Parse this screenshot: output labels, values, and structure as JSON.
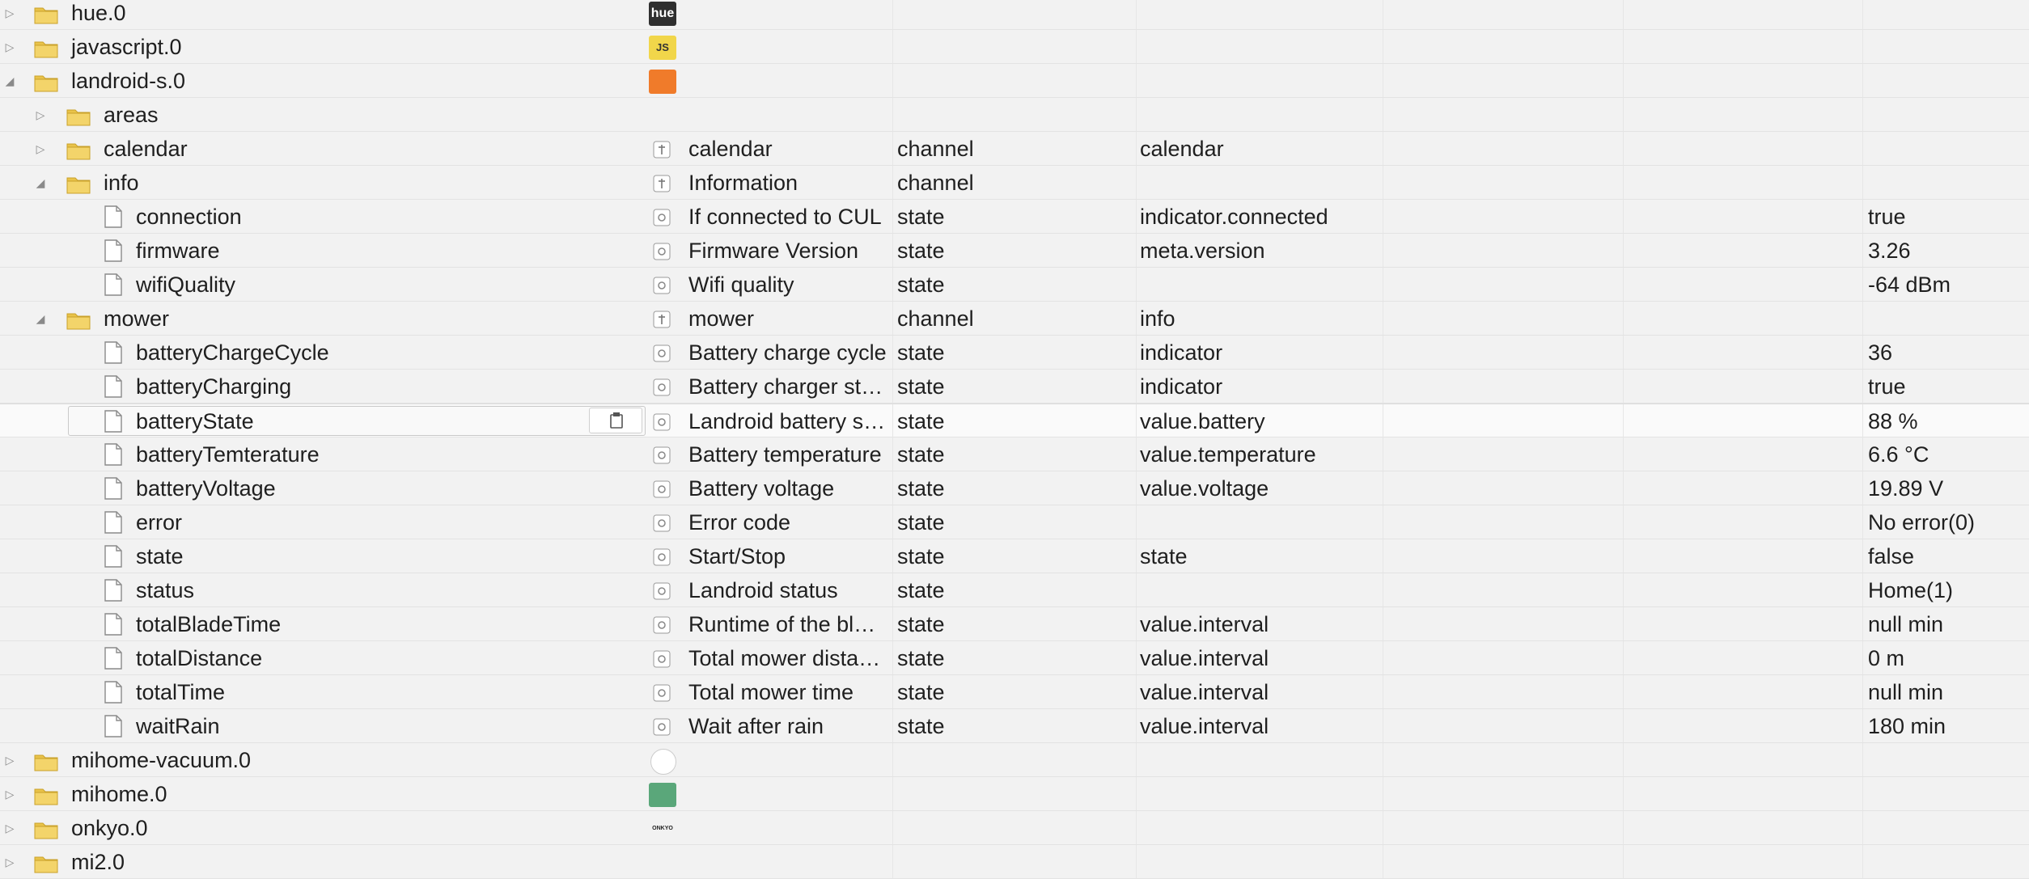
{
  "rows": [
    {
      "kind": "adapter",
      "name": "hue.0",
      "expanded": false,
      "icon": "hue-adapter-icon",
      "icon_text": "hue"
    },
    {
      "kind": "adapter",
      "name": "javascript.0",
      "expanded": false,
      "icon": "javascript-adapter-icon",
      "icon_text": "JS"
    },
    {
      "kind": "adapter",
      "name": "landroid-s.0",
      "expanded": true,
      "icon": "landroid-adapter-icon",
      "icon_text": ""
    },
    {
      "kind": "folder",
      "level": 1,
      "name": "areas",
      "expanded": false
    },
    {
      "kind": "channel",
      "level": 1,
      "name": "calendar",
      "expanded": false,
      "col_name": "calendar",
      "type": "channel",
      "role": "calendar",
      "value": ""
    },
    {
      "kind": "channel",
      "level": 1,
      "name": "info",
      "expanded": true,
      "col_name": "Information",
      "type": "channel",
      "role": "",
      "value": ""
    },
    {
      "kind": "state",
      "level": 2,
      "name": "connection",
      "col_name": "If connected to CUL",
      "type": "state",
      "role": "indicator.connected",
      "value": "true"
    },
    {
      "kind": "state",
      "level": 2,
      "name": "firmware",
      "col_name": "Firmware Version",
      "type": "state",
      "role": "meta.version",
      "value": "3.26"
    },
    {
      "kind": "state",
      "level": 2,
      "name": "wifiQuality",
      "col_name": "Wifi quality",
      "type": "state",
      "role": "",
      "value": "-64 dBm"
    },
    {
      "kind": "channel",
      "level": 1,
      "name": "mower",
      "expanded": true,
      "col_name": "mower",
      "type": "channel",
      "role": "info",
      "value": ""
    },
    {
      "kind": "state",
      "level": 2,
      "name": "batteryChargeCycle",
      "col_name": "Battery charge cycle",
      "type": "state",
      "role": "indicator",
      "value": "36"
    },
    {
      "kind": "state",
      "level": 2,
      "name": "batteryCharging",
      "col_name": "Battery charger st…",
      "type": "state",
      "role": "indicator",
      "value": "true"
    },
    {
      "kind": "state",
      "level": 2,
      "name": "batteryState",
      "col_name": "Landroid battery s…",
      "type": "state",
      "role": "value.battery",
      "value": "88 %",
      "selected": true
    },
    {
      "kind": "state",
      "level": 2,
      "name": "batteryTemterature",
      "col_name": "Battery temperature",
      "type": "state",
      "role": "value.temperature",
      "value": "6.6 °C"
    },
    {
      "kind": "state",
      "level": 2,
      "name": "batteryVoltage",
      "col_name": "Battery voltage",
      "type": "state",
      "role": "value.voltage",
      "value": "19.89 V"
    },
    {
      "kind": "state",
      "level": 2,
      "name": "error",
      "col_name": "Error code",
      "type": "state",
      "role": "",
      "value": "No error(0)"
    },
    {
      "kind": "state",
      "level": 2,
      "name": "state",
      "col_name": "Start/Stop",
      "type": "state",
      "role": "state",
      "value": "false"
    },
    {
      "kind": "state",
      "level": 2,
      "name": "status",
      "col_name": "Landroid status",
      "type": "state",
      "role": "",
      "value": "Home(1)"
    },
    {
      "kind": "state",
      "level": 2,
      "name": "totalBladeTime",
      "col_name": "Runtime of the bl…",
      "type": "state",
      "role": "value.interval",
      "value": "null min"
    },
    {
      "kind": "state",
      "level": 2,
      "name": "totalDistance",
      "col_name": "Total mower dista…",
      "type": "state",
      "role": "value.interval",
      "value": "0 m"
    },
    {
      "kind": "state",
      "level": 2,
      "name": "totalTime",
      "col_name": "Total mower time",
      "type": "state",
      "role": "value.interval",
      "value": "null min"
    },
    {
      "kind": "state",
      "level": 2,
      "name": "waitRain",
      "col_name": "Wait after rain",
      "type": "state",
      "role": "value.interval",
      "value": "180 min"
    },
    {
      "kind": "adapter",
      "name": "mihome-vacuum.0",
      "expanded": false,
      "icon": "vacuum-adapter-icon",
      "icon_text": ""
    },
    {
      "kind": "adapter",
      "name": "mihome.0",
      "expanded": false,
      "icon": "mihome-adapter-icon",
      "icon_text": ""
    },
    {
      "kind": "adapter",
      "name": "onkyo.0",
      "expanded": false,
      "icon": "onkyo-adapter-icon",
      "icon_text": "ONKYO"
    },
    {
      "kind": "adapter",
      "name": "mi2.0",
      "expanded": false,
      "icon": "mi2-adapter-icon",
      "icon_text": ""
    }
  ],
  "colors": {
    "folder": "#e9c34a",
    "row_border": "#e3e3e3",
    "js_icon": "#f1d64a",
    "landroid_icon": "#f07b2a",
    "mihome_icon": "#5aa77a",
    "hue_icon": "#2f2f2f"
  }
}
